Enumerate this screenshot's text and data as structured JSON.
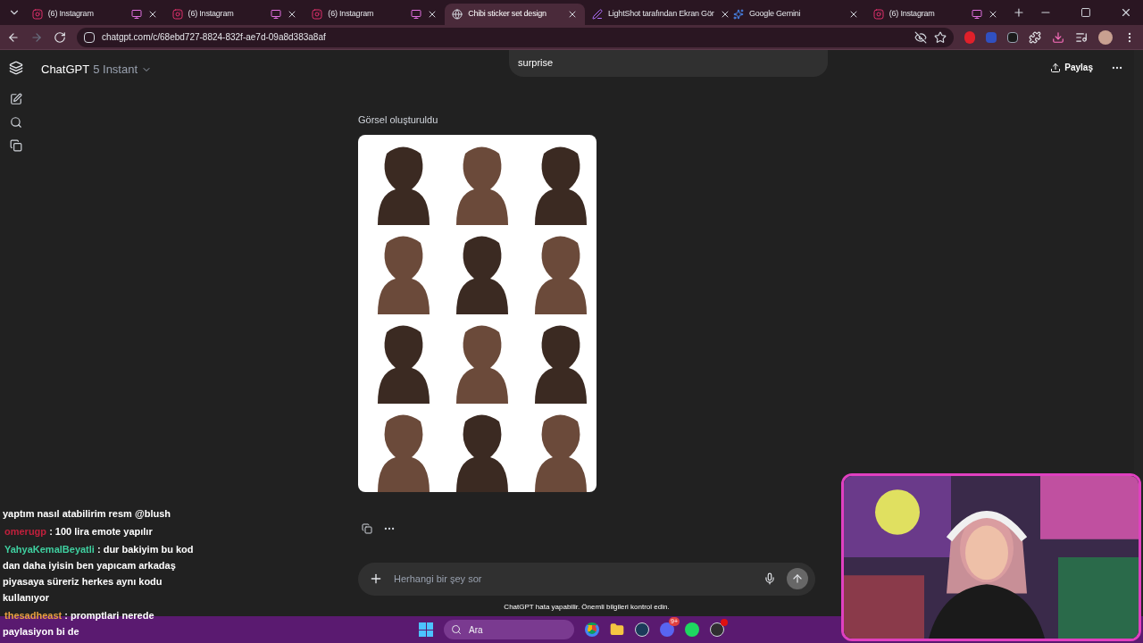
{
  "tabs": [
    {
      "label": "(6) Instagram",
      "kind": "instagram",
      "media": true,
      "selected": false
    },
    {
      "label": "(6) Instagram",
      "kind": "instagram",
      "media": true,
      "selected": false
    },
    {
      "label": "(6) Instagram",
      "kind": "instagram",
      "media": true,
      "selected": false
    },
    {
      "label": "Chibi sticker set design",
      "kind": "web",
      "media": false,
      "selected": true
    },
    {
      "label": "LightShot tarafından Ekran Gör",
      "kind": "pen",
      "media": false,
      "selected": false
    },
    {
      "label": "Google Gemini",
      "kind": "gemini",
      "media": false,
      "selected": false
    },
    {
      "label": "(6) Instagram",
      "kind": "instagram",
      "media": true,
      "selected": false
    }
  ],
  "address": "chatgpt.com/c/68ebd727-8824-832f-ae7d-09a8d383a8af",
  "header": {
    "title": "ChatGPT",
    "model": "5 Instant",
    "share": "Paylaş"
  },
  "user_message": "surprise",
  "image_caption": "Görsel oluşturuldu",
  "composer": {
    "placeholder": "Herhangi bir şey sor"
  },
  "disclaimer": "ChatGPT hata yapabilir. Önemli bilgileri kontrol edin.",
  "taskbar": {
    "search": "Ara",
    "discord_badge": "9+"
  },
  "stream_chat": [
    {
      "text": "yaptım nasıl atabilirim resm @blush"
    },
    {
      "user": "omerugp",
      "color": "#c0203c",
      "text": ": 100 lira emote yapılır"
    },
    {
      "user": "YahyaKemalBeyatli",
      "color": "#3fd0a0",
      "text": ": dur bakiyim bu kod dan daha iyisin ben yapıcam arkadaş piyasaya süreriz herkes aynı kodu kullanıyor"
    },
    {
      "user": "thesadheast",
      "color": "#e8a040",
      "text": ": promptlari nerede paylasiyon bi de"
    }
  ]
}
